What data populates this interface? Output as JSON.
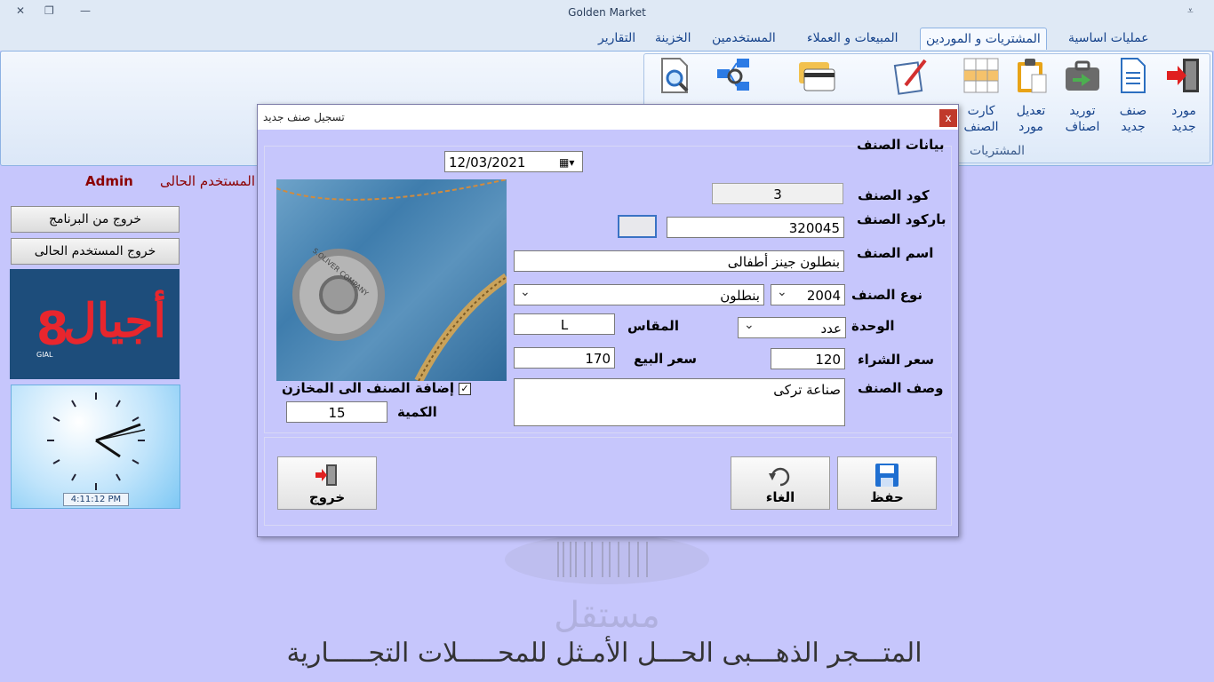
{
  "window": {
    "title": "Golden Market"
  },
  "tabs": [
    "عمليات اساسية",
    "المشتريات و الموردين",
    "المبيعات و العملاء",
    "المستخدمين",
    "الخزينة",
    "التقارير"
  ],
  "ribbon": {
    "group_label": "المشتريات",
    "buttons": [
      {
        "label1": "مورد",
        "label2": "جديد",
        "icon": "door-exit-icon"
      },
      {
        "label1": "صنف",
        "label2": "جديد",
        "icon": "document-icon"
      },
      {
        "label1": "توريد",
        "label2": "اصناف",
        "icon": "briefcase-icon"
      },
      {
        "label1": "تعديل",
        "label2": "مورد",
        "icon": "clipboard-icon"
      },
      {
        "label1": "كارت",
        "label2": "الصنف",
        "icon": "grid-icon"
      },
      {
        "label1": "",
        "label2": "",
        "icon": "edit-document-icon"
      },
      {
        "label1": "",
        "label2": "",
        "icon": "cards-icon"
      },
      {
        "label1": "",
        "label2": "",
        "icon": "network-search-icon"
      },
      {
        "label1": "",
        "label2": "",
        "icon": "document-search-icon"
      }
    ]
  },
  "user": {
    "label": "المستخدم الحالى :",
    "name": "Admin"
  },
  "sidebar": {
    "exit_program": "خروج من البرنامج",
    "exit_user": "خروج المستخدم الحالى",
    "logo_text": "أجيال",
    "logo_sub": "GIAL"
  },
  "clock": {
    "time": "4:11:12 PM"
  },
  "slogan": "المتـــجر الذهـــبى الحـــل الأمـثل للمحـــــلات التجـــــارية",
  "watermark": "مستقل",
  "dialog": {
    "title": "تسجيل صنف جديد",
    "close": "x",
    "section_title": "بيانات الصنف",
    "date": "12/03/2021",
    "fields": {
      "code_label": "كود الصنف",
      "code_value": "3",
      "barcode_label": "باركود الصنف",
      "barcode_value": "320045",
      "name_label": "اسم الصنف",
      "name_value": "بنطلون جينز أطفالى",
      "type_label": "نوع الصنف",
      "type_code": "2004",
      "type_name": "بنطلون",
      "unit_label": "الوحدة",
      "unit_value": "عدد",
      "size_label": "المقاس",
      "size_value": "L",
      "buy_label": "سعر الشراء",
      "buy_value": "120",
      "sell_label": "سعر البيع",
      "sell_value": "170",
      "desc_label": "وصف الصنف",
      "desc_value": "صناعة تركى",
      "add_store_label": "إضافة الصنف الى المخازن",
      "qty_label": "الكمية",
      "qty_value": "15"
    },
    "photo_text": "S.OLIVER COMPANY",
    "buttons": {
      "save": "حفظ",
      "cancel": "الغاء",
      "exit": "خروج"
    }
  }
}
